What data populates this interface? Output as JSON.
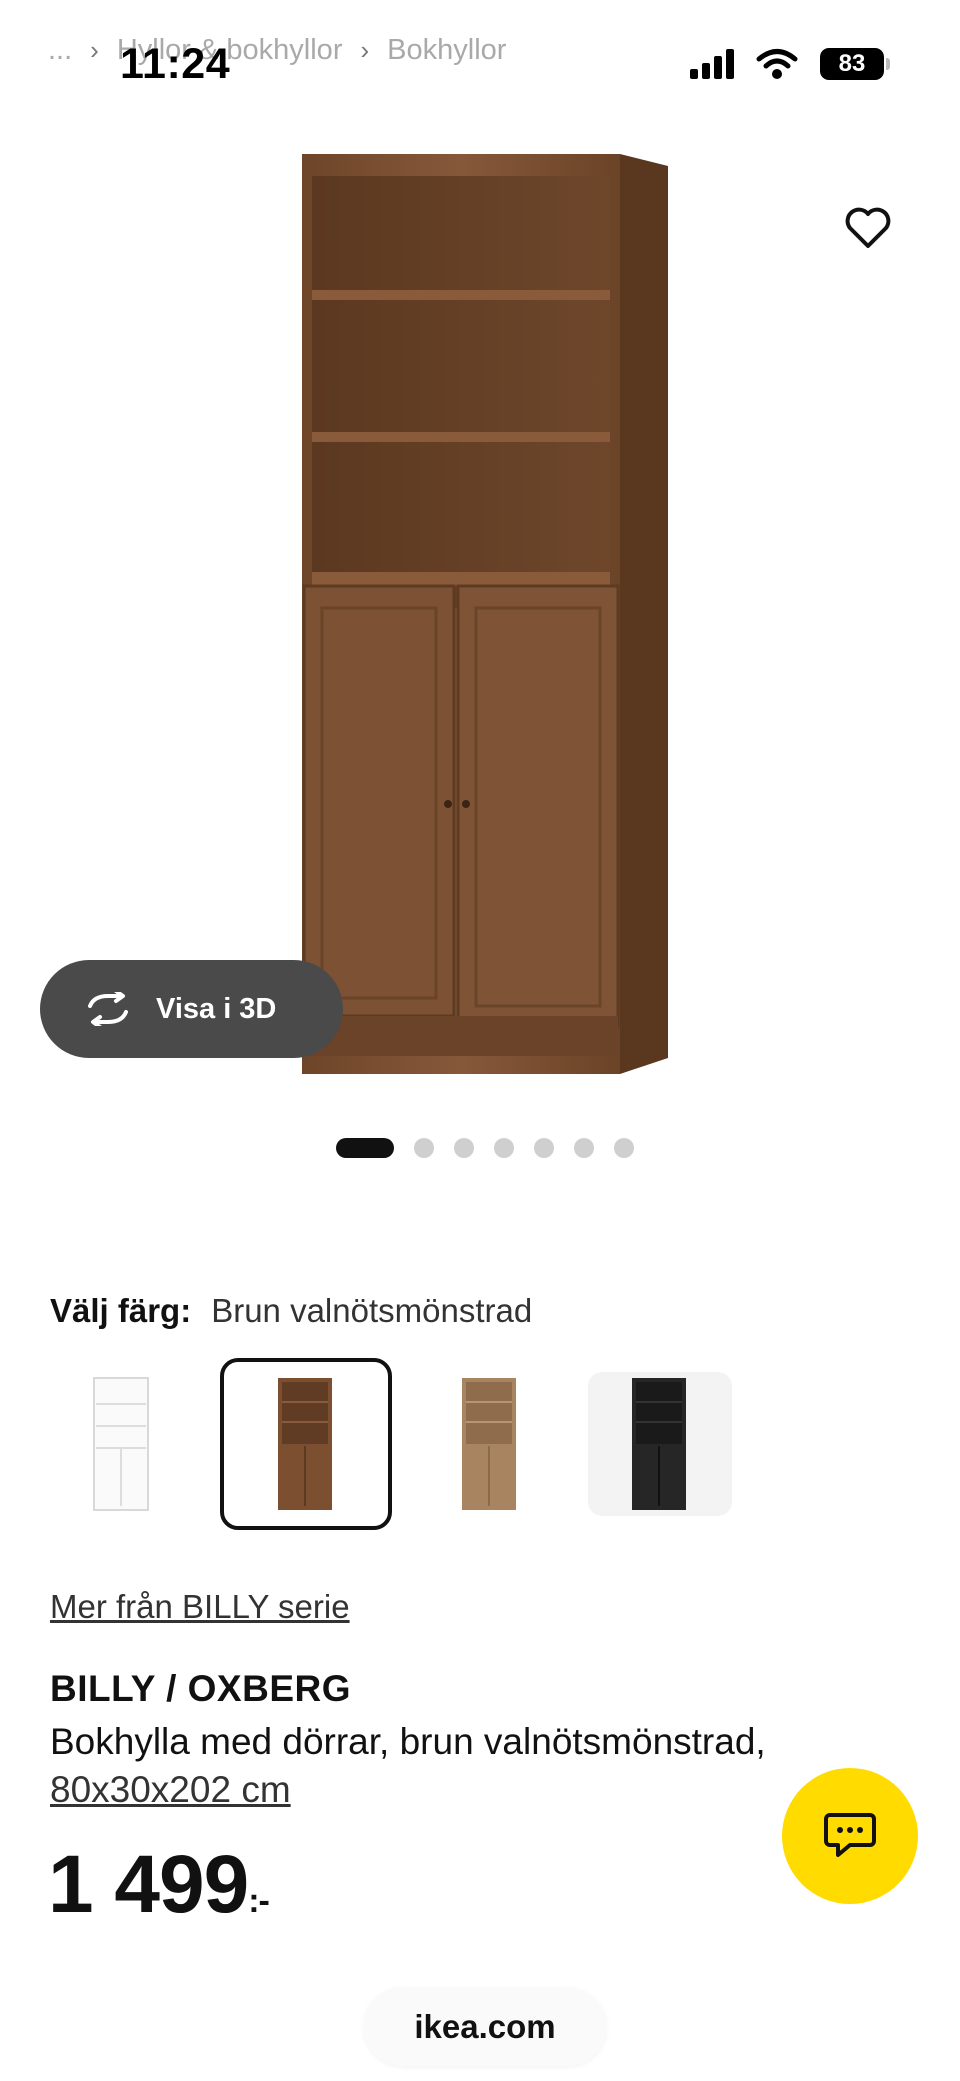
{
  "breadcrumb": {
    "ellipsis": "...",
    "items": [
      "Hyllor & bokhyllor",
      "Bokhyllor"
    ]
  },
  "status_bar": {
    "time": "11:24",
    "battery": "83"
  },
  "gallery": {
    "view_3d_label": "Visa i 3D",
    "image_count": 7,
    "active_index": 0
  },
  "color_picker": {
    "label": "Välj färg:",
    "selected_value": "Brun valnötsmönstrad",
    "options": [
      "white",
      "brown walnut",
      "oak effect",
      "black"
    ]
  },
  "series_link": "Mer från BILLY serie",
  "product": {
    "name": "BILLY / OXBERG",
    "description": "Bokhylla med dörrar, brun valnötsmönstrad,",
    "dimensions": "80x30x202 cm",
    "price": "1 499",
    "currency_suffix": ":-"
  },
  "browser": {
    "url": "ikea.com"
  },
  "colors": {
    "chat_button": "#ffdb00",
    "wood": "#7b4f30"
  }
}
